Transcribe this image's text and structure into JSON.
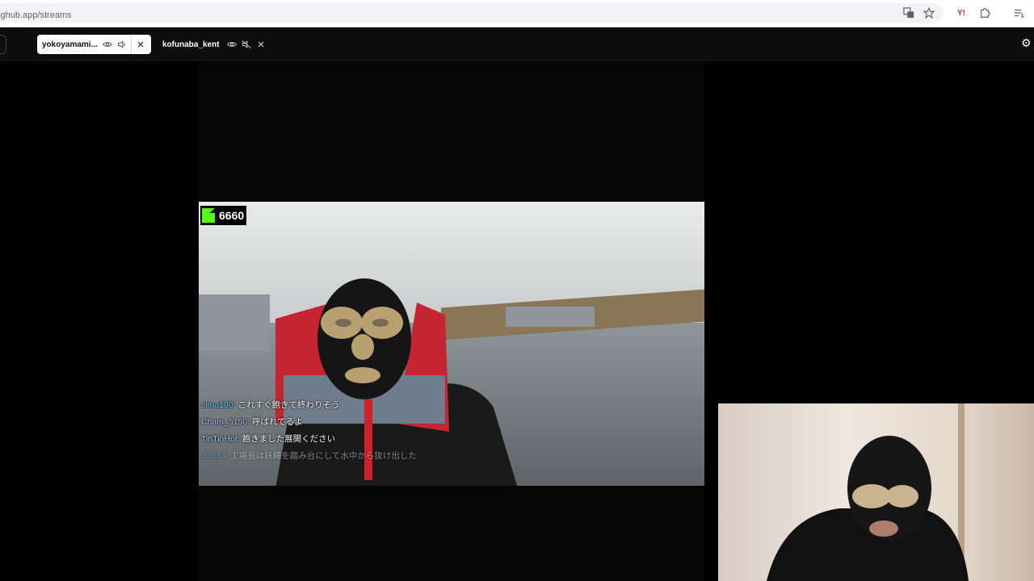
{
  "browser": {
    "url": "inghub.app/streams",
    "icons": [
      "translate-icon",
      "bookmark-star-icon",
      "yahoo-icon",
      "extensions-icon",
      "reading-list-icon"
    ]
  },
  "tabs": [
    {
      "label": "yokoyamami...",
      "state": "active"
    },
    {
      "label": "kofunaba_kent",
      "state": "inactive"
    }
  ],
  "stream": {
    "platform_icon": "kick-logo-icon",
    "viewer_count": "6660",
    "chat": [
      {
        "user": "sima190:",
        "message": "これすぐ飽きて終わりそう",
        "color": "#6fc3ff"
      },
      {
        "user": "Cham_5150:",
        "message": "呼ばれてるよ",
        "color": "#c9b8ff"
      },
      {
        "user": "TinTinHot:",
        "message": "飽きました展開ください",
        "color": "#9ed3ff"
      },
      {
        "user": "Jizo14:",
        "message": "工場長は妖精を踏み台にして水中から抜け出した",
        "color": "#6fc3ff"
      }
    ]
  },
  "colors": {
    "kick_green": "#53fc18",
    "header_bg": "#0d0d0d"
  }
}
